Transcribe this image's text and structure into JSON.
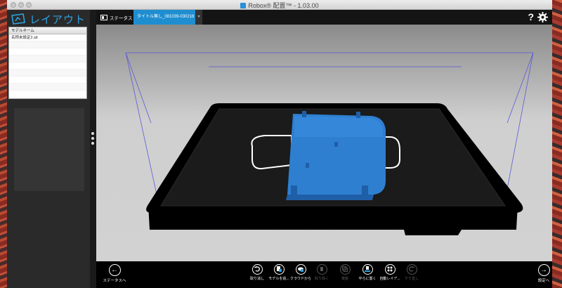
{
  "window": {
    "title": "Robox® 配置™ - 1.03.00"
  },
  "sidebar": {
    "logo_text": "レイアウト",
    "model_panel": {
      "header": "モデルネーム",
      "items": [
        "名称未設定2.stl"
      ]
    }
  },
  "topbar": {
    "status_tab": "ステータス",
    "project_tab": "タイトル無し_081039-030216",
    "add_tab": "▾",
    "help_label": "?"
  },
  "bottombar": {
    "back_label": "ステータスへ",
    "forward_label": "設定へ",
    "tools": [
      {
        "label": "取り消し",
        "icon": "undo-icon",
        "enabled": true
      },
      {
        "label": "モデルを追...",
        "icon": "add-model-icon",
        "enabled": true
      },
      {
        "label": "クラウドから",
        "icon": "cloud-icon",
        "enabled": true
      },
      {
        "label": "取り除く",
        "icon": "delete-icon",
        "enabled": false
      },
      {
        "label": "複製",
        "icon": "duplicate-icon",
        "enabled": false
      },
      {
        "label": "平らに置く",
        "icon": "lay-flat-icon",
        "enabled": true
      },
      {
        "label": "自動レイア...",
        "icon": "auto-layout-icon",
        "enabled": true
      },
      {
        "label": "やり直し",
        "icon": "redo-icon",
        "enabled": false
      }
    ]
  },
  "colors": {
    "accent": "#1f8ed0",
    "model": "#2e7fd0",
    "bed_frame": "#000000",
    "viewport_bg": "#cfcfcf"
  }
}
